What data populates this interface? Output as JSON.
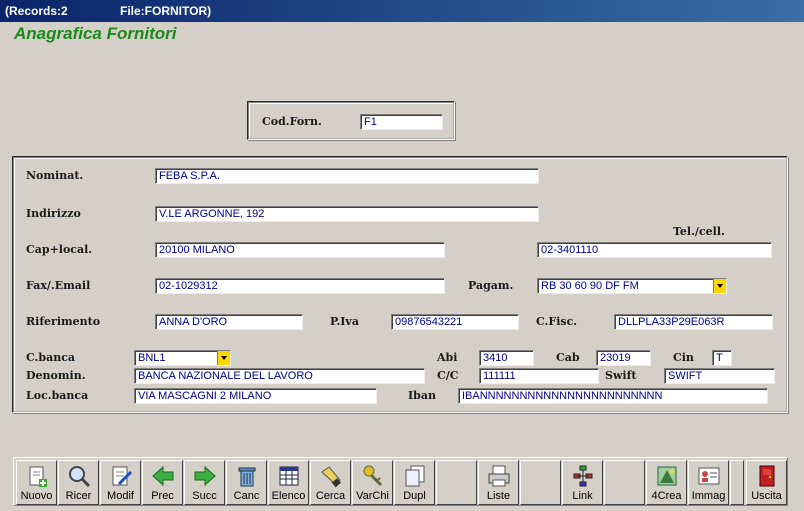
{
  "window": {
    "records": "(Records:2",
    "file": "File:FORNITOR)"
  },
  "heading": "Anagrafica Fornitori",
  "code": {
    "label": "Cod.Forn.",
    "value": "F1"
  },
  "fields": {
    "nominat": {
      "label": "Nominat.",
      "value": "FEBA S.P.A."
    },
    "indirizzo": {
      "label": "Indirizzo",
      "value": "V.LE ARGONNE, 192"
    },
    "cap": {
      "label": "Cap+local.",
      "value": "20100 MILANO"
    },
    "tel": {
      "label": "Tel./cell.",
      "value": "02-3401110"
    },
    "fax": {
      "label": "Fax/.Email",
      "value": "02-1029312"
    },
    "pagam": {
      "label": "Pagam.",
      "value": "RB 30 60 90 DF FM"
    },
    "riferimento": {
      "label": "Riferimento",
      "value": "ANNA D'ORO"
    },
    "piva": {
      "label": "P.Iva",
      "value": "09876543221"
    },
    "cfisc": {
      "label": "C.Fisc.",
      "value": "DLLPLA33P29E063R"
    },
    "cbanca": {
      "label": "C.banca",
      "value": "BNL1"
    },
    "abi": {
      "label": "Abi",
      "value": "3410"
    },
    "cab": {
      "label": "Cab",
      "value": "23019"
    },
    "cin": {
      "label": "Cin",
      "value": "T"
    },
    "denomin": {
      "label": "Denomin.",
      "value": "BANCA NAZIONALE DEL LAVORO"
    },
    "cc": {
      "label": "C/C",
      "value": "111111"
    },
    "swift": {
      "label": "Swift",
      "value": "SWIFT"
    },
    "locbanca": {
      "label": "Loc.banca",
      "value": "VIA MASCAGNI 2  MILANO"
    },
    "iban": {
      "label": "Iban",
      "value": "IBANNNNNNNNNNNNNNNNNNNNNNN"
    }
  },
  "toolbar": [
    {
      "label": "Nuovo",
      "icon": "new-document-icon"
    },
    {
      "label": "Ricer",
      "icon": "search-icon"
    },
    {
      "label": "Modif",
      "icon": "edit-icon"
    },
    {
      "label": "Prec",
      "icon": "arrow-left-icon"
    },
    {
      "label": "Succ",
      "icon": "arrow-right-icon"
    },
    {
      "label": "Canc",
      "icon": "trash-icon"
    },
    {
      "label": "Elenco",
      "icon": "table-icon"
    },
    {
      "label": "Cerca",
      "icon": "flashlight-icon"
    },
    {
      "label": "VarChi",
      "icon": "keys-icon"
    },
    {
      "label": "Dupl",
      "icon": "duplicate-icon"
    },
    {
      "label": "",
      "icon": ""
    },
    {
      "label": "Liste",
      "icon": "printer-icon"
    },
    {
      "label": "",
      "icon": ""
    },
    {
      "label": "Link",
      "icon": "link-icon"
    },
    {
      "label": "",
      "icon": ""
    },
    {
      "label": "4Crea",
      "icon": "create-icon"
    },
    {
      "label": "Immag",
      "icon": "image-card-icon"
    },
    {
      "label": "",
      "icon": ""
    },
    {
      "label": "Uscita",
      "icon": "exit-door-icon"
    }
  ]
}
